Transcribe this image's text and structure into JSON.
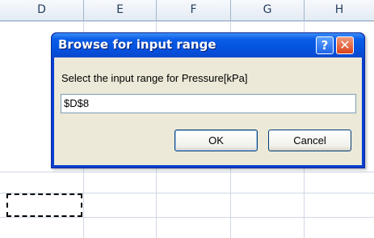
{
  "spreadsheet": {
    "columns": [
      "D",
      "E",
      "F",
      "G",
      "H"
    ]
  },
  "dialog": {
    "title": "Browse for input range",
    "help_icon": "question-mark",
    "help_glyph": "?",
    "close_icon": "x-mark",
    "close_glyph": "✕",
    "prompt": "Select the input range for Pressure[kPa]",
    "range_value": "$D$8",
    "ok_label": "OK",
    "cancel_label": "Cancel"
  },
  "colors": {
    "titlebar": "#0a5de8",
    "dialog_body": "#ece9d8",
    "close_button": "#d8431a"
  }
}
